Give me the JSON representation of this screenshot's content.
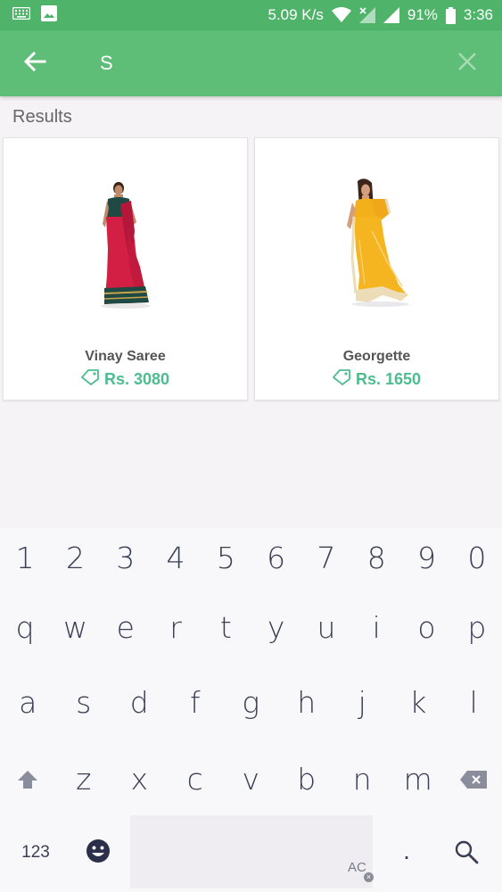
{
  "status_bar": {
    "network_speed": "5.09 K/s",
    "battery": "91%",
    "time": "3:36",
    "icons": [
      "keyboard-icon",
      "image-icon",
      "wifi-icon",
      "signal-x-icon",
      "signal-icon",
      "battery-icon"
    ]
  },
  "app_bar": {
    "search_value": "S",
    "back_icon": "arrow-left-icon",
    "clear_icon": "close-icon",
    "accent": "#5ebd77"
  },
  "results": {
    "heading": "Results",
    "products": [
      {
        "name": "Vinay Saree",
        "price": "Rs. 3080",
        "price_icon": "price-tag-icon",
        "image": "red-saree"
      },
      {
        "name": "Georgette",
        "price": "Rs. 1650",
        "price_icon": "price-tag-icon",
        "image": "yellow-saree"
      }
    ],
    "price_color": "#4dbd8f"
  },
  "keyboard": {
    "numbers": [
      "1",
      "2",
      "3",
      "4",
      "5",
      "6",
      "7",
      "8",
      "9",
      "0"
    ],
    "row1": [
      "q",
      "w",
      "e",
      "r",
      "t",
      "y",
      "u",
      "i",
      "o",
      "p"
    ],
    "row2": [
      "a",
      "s",
      "d",
      "f",
      "g",
      "h",
      "j",
      "k",
      "l"
    ],
    "row3": [
      "z",
      "x",
      "c",
      "v",
      "b",
      "n",
      "m"
    ],
    "symbols_key": "123",
    "autocorrect_key": "AC",
    "period_key": "."
  }
}
